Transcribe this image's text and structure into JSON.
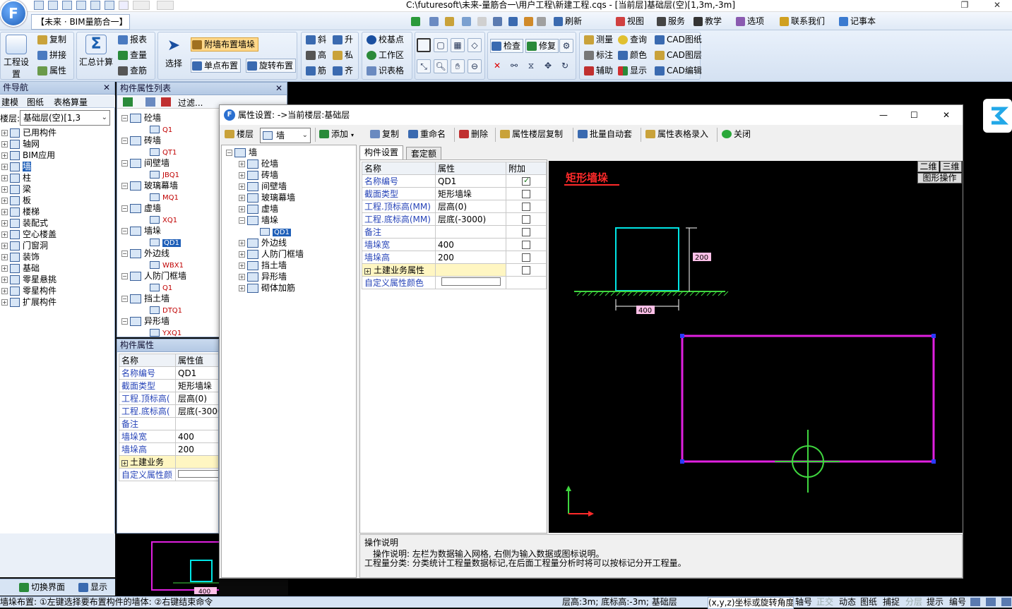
{
  "window": {
    "title": "C:\\futuresoft\\未来-量筋合一\\用户工程\\新建工程.cqs - [当前层]基础层(空)[1,3m,-3m]",
    "project_tab": "【未来 · BIM量筋合一】"
  },
  "menu": {
    "items": [
      "刷新",
      "视图",
      "服务",
      "教学",
      "选项",
      "联系我们",
      "记事本"
    ]
  },
  "ribbon": {
    "project_settings": "工程设置",
    "copy": "复制",
    "splice": "拼接",
    "property": "属性",
    "summary_calc": "汇总计算",
    "report": "报表",
    "check_qty": "查量",
    "check_rebar": "查筋",
    "select": "选择",
    "attach_wall_pier": "附墙布置墙垛",
    "single_place": "单点布置",
    "rotate_place": "旋转布置",
    "slant": "斜",
    "rise": "升",
    "height": "高",
    "private": "私",
    "rebar": "筋",
    "align": "齐",
    "calibrate": "校基点",
    "work_area": "工作区",
    "grid_recognize": "识表格",
    "check": "检查",
    "repair": "修复",
    "measure": "测量",
    "query": "查询",
    "cad_drawing": "CAD图纸",
    "annotate": "标注",
    "color": "颜色",
    "cad_layer": "CAD图层",
    "auxiliary": "辅助",
    "display": "显示",
    "cad_edit": "CAD编辑"
  },
  "nav_panel": {
    "header": "件导航",
    "tabs": [
      "建模",
      "图纸",
      "表格算量"
    ],
    "floor_label": "楼层:",
    "floor_value": "基础层(空)[1,3",
    "items": [
      "已用构件",
      "轴网",
      "BIM应用",
      "墙",
      "柱",
      "梁",
      "板",
      "楼梯",
      "装配式",
      "空心楼盖",
      "门窗洞",
      "装饰",
      "基础",
      "零星悬挑",
      "零星构件",
      "扩展构件"
    ],
    "switch_ui": "切换界面",
    "display": "显示"
  },
  "comp_list": {
    "header": "构件属性列表",
    "filter": "过滤...",
    "groups": [
      {
        "name": "砼墙",
        "child": "Q1"
      },
      {
        "name": "砖墙",
        "child": "QT1"
      },
      {
        "name": "间壁墙",
        "child": "JBQ1"
      },
      {
        "name": "玻璃幕墙",
        "child": "MQ1"
      },
      {
        "name": "虚墙",
        "child": "XQ1"
      },
      {
        "name": "墙垛",
        "child": "QD1"
      },
      {
        "name": "外边线",
        "child": "WBX1"
      },
      {
        "name": "人防门框墙",
        "child": "Q1"
      },
      {
        "name": "挡土墙",
        "child": "DTQ1"
      },
      {
        "name": "异形墙",
        "child": "YXQ1"
      }
    ]
  },
  "comp_props": {
    "header": "构件属性",
    "col_name": "名称",
    "col_value": "属性值",
    "rows": [
      {
        "k": "名称编号",
        "v": "QD1"
      },
      {
        "k": "截面类型",
        "v": "矩形墙垛"
      },
      {
        "k": "工程.顶标高(",
        "v": "层高(0)"
      },
      {
        "k": "工程.底标高(",
        "v": "层底(-3000"
      },
      {
        "k": "备注",
        "v": ""
      },
      {
        "k": "墙垛宽",
        "v": "400"
      },
      {
        "k": "墙垛高",
        "v": "200"
      },
      {
        "k": "土建业务",
        "v": ""
      },
      {
        "k": "自定义属性颜",
        "v": ""
      }
    ],
    "mini_dim": "400"
  },
  "dialog": {
    "title": "属性设置: ->当前楼层:基础层",
    "floor_btn": "楼层",
    "type_combo": "墙",
    "add": "添加",
    "copy": "复制",
    "rename": "重命名",
    "delete": "删除",
    "copy_floor_props": "属性楼层复制",
    "batch_auto": "批量自动套",
    "table_entry": "属性表格录入",
    "close": "关闭",
    "tree_root": "墙",
    "tree": [
      "砼墙",
      "砖墙",
      "间壁墙",
      "玻璃幕墙",
      "虚墙",
      "墙垛",
      "外边线",
      "人防门框墙",
      "挡土墙",
      "异形墙",
      "砌体加筋"
    ],
    "tree_selected": "QD1",
    "tab_comp_settings": "构件设置",
    "tab_quota": "套定额",
    "col_name": "名称",
    "col_attr": "属性",
    "col_extra": "附加",
    "rows": [
      {
        "k": "名称编号",
        "v": "QD1",
        "checked": true
      },
      {
        "k": "截面类型",
        "v": "矩形墙垛",
        "checked": false
      },
      {
        "k": "工程.顶标高(MM)",
        "v": "层高(0)",
        "checked": false
      },
      {
        "k": "工程.底标高(MM)",
        "v": "层底(-3000)",
        "checked": false
      },
      {
        "k": "备注",
        "v": "",
        "checked": false
      },
      {
        "k": "墙垛宽",
        "v": "400",
        "checked": false
      },
      {
        "k": "墙垛高",
        "v": "200",
        "checked": false
      },
      {
        "k": "土建业务属性",
        "v": "",
        "checked": false
      },
      {
        "k": "自定义属性颜色",
        "v": "",
        "checked": null
      }
    ],
    "preview_title": "矩形墙垛",
    "btn_2d": "二维",
    "btn_3d": "三维",
    "btn_graphic_ops": "图形操作",
    "dim_height": "200",
    "dim_width": "400",
    "op_title": "操作说明",
    "op_line1": "操作说明: 左栏为数据输入网格, 右侧为输入数据或图标说明。",
    "op_line2": "工程量分类: 分类统计工程量数据标记,在后面工程量分析时将可以按标记分开工程量。"
  },
  "status": {
    "left": "墙垛布置: ①左键选择要布置构件的墙体: ②右键结束命令",
    "floor_info": "层高:3m; 底标高:-3m; 基础层",
    "coord": "(x,y,z)坐标或旋转角度",
    "items": [
      "轴号",
      "正交",
      "动态",
      "图纸",
      "捕捉",
      "分层",
      "提示",
      "编号"
    ]
  },
  "colors": {
    "accent": "#1f5fb8",
    "canvas_bg": "#000000",
    "pier_cyan": "#00e5e5",
    "outline_magenta": "#e020e0",
    "ground_green": "#3fd63f",
    "label_pink": "#ffc0e8",
    "title_red": "#ff2a2a"
  }
}
